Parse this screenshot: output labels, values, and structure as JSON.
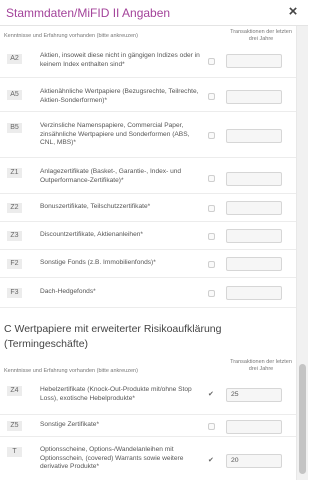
{
  "header": {
    "title": "Stammdaten/MiFID II Angaben",
    "close_label": "×"
  },
  "section_b": {
    "col_left": "Kenntnisse und Erfahrung vorhanden (bitte ankreuzen)",
    "col_right": "Transaktionen der letzten drei Jahre",
    "rows": [
      {
        "code": "A2",
        "text": "Aktien, insoweit diese nicht in gängigen Indizes oder in keinem Index enthalten sind*",
        "checked": false,
        "amount": ""
      },
      {
        "code": "A5",
        "text": "Aktienähnliche Wertpapiere (Bezugsrechte, Teilrechte, Aktien-Sonderformen)*",
        "checked": false,
        "amount": ""
      },
      {
        "code": "B5",
        "text": "Verzinsliche Namenspapiere, Commercial Paper, zinsähnliche Wertpapiere und Sonderformen (ABS, CNL, MBS)*",
        "checked": false,
        "amount": ""
      },
      {
        "code": "Z1",
        "text": "Anlagezertifikate (Basket-, Garantie-, Index- und Outperformance-Zertifikate)*",
        "checked": false,
        "amount": ""
      },
      {
        "code": "Z2",
        "text": "Bonuszertifikate, Teilschutzzertifikate*",
        "checked": false,
        "amount": ""
      },
      {
        "code": "Z3",
        "text": "Discountzertifikate, Aktienanleihen*",
        "checked": false,
        "amount": ""
      },
      {
        "code": "F2",
        "text": "Sonstige Fonds (z.B. Immobilienfonds)*",
        "checked": false,
        "amount": ""
      },
      {
        "code": "F3",
        "text": "Dach-Hedgefonds*",
        "checked": false,
        "amount": ""
      }
    ]
  },
  "section_c": {
    "title": "C Wertpapiere mit erweiterter Risikoaufklärung (Termingeschäfte)",
    "col_left": "Kenntnisse und Erfahrung vorhanden (bitte ankreuzen)",
    "col_right": "Transaktionen der letzten drei Jahre",
    "rows": [
      {
        "code": "Z4",
        "text": "Hebelzertifikate (Knock-Out-Produkte mit/ohne Stop Loss), exotische Hebelprodukte*",
        "checked": true,
        "amount": "25"
      },
      {
        "code": "Z5",
        "text": "Sonstige Zertifikate*",
        "checked": false,
        "amount": ""
      },
      {
        "code": "T",
        "text": "Optionsscheine, Options-/Wandelanleihen mit Optionsschein, (covered) Warrants sowie weitere derivative Produkte*",
        "checked": true,
        "amount": "20"
      }
    ]
  },
  "colors": {
    "title": "#a3439a",
    "code_bg": "#ececec"
  }
}
